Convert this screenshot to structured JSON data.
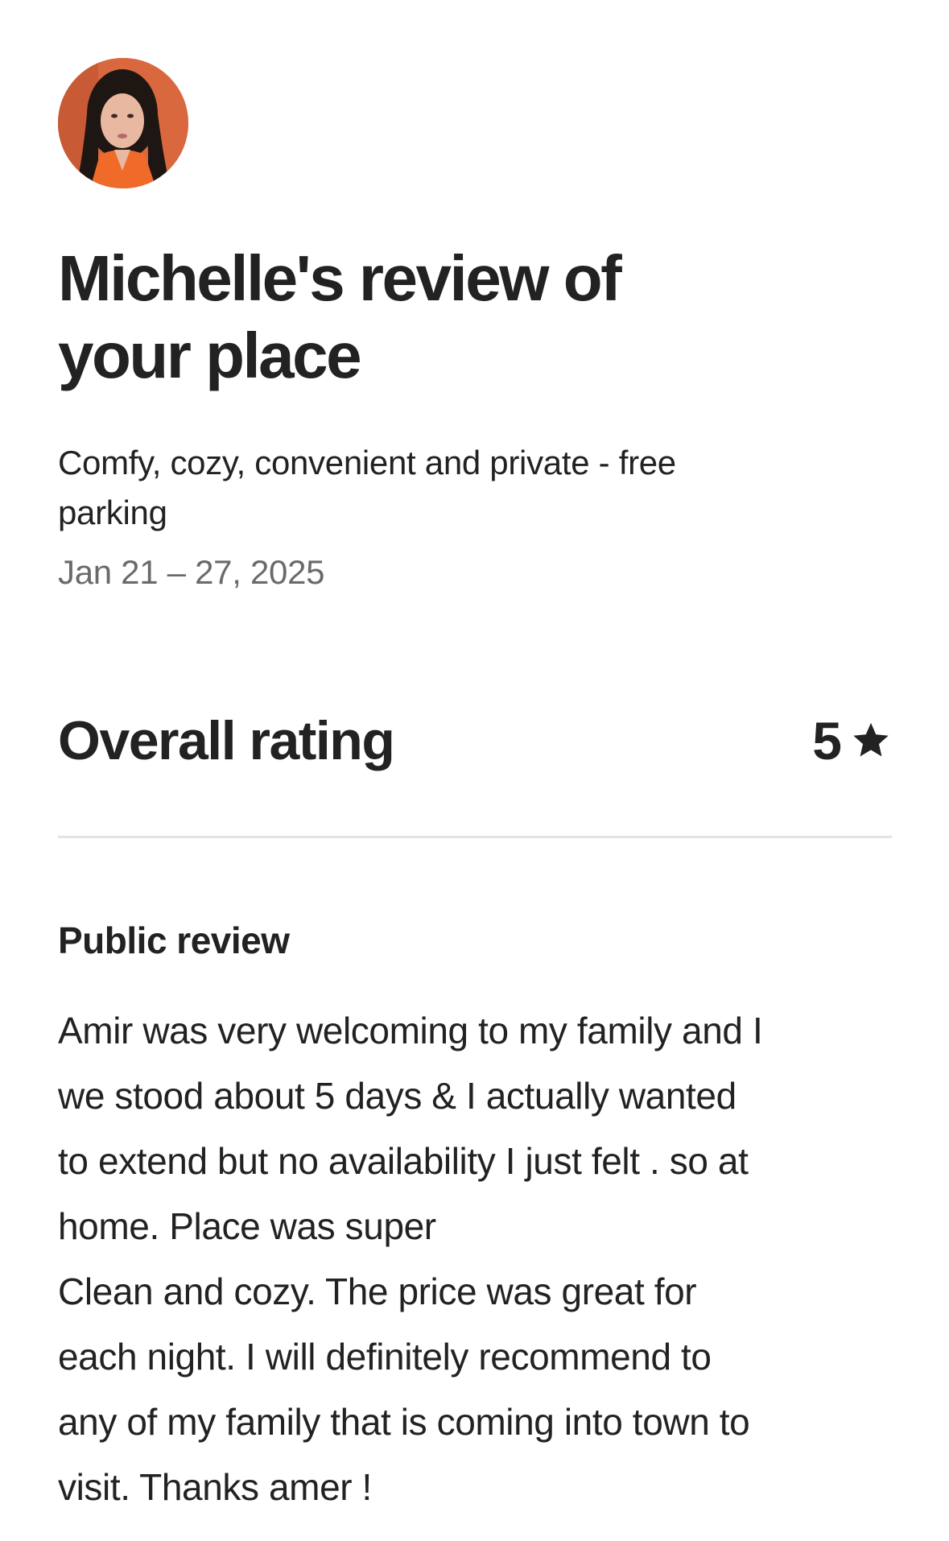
{
  "reviewer": {
    "avatar_icon": "reviewer-avatar-photo",
    "avatar_colors": {
      "background": "#e0552d",
      "hair": "#1e1612",
      "skin": "#e8b8a0",
      "top": "#f06a2a"
    }
  },
  "header": {
    "title": "Michelle's review of your place"
  },
  "listing": {
    "name": "Comfy, cozy, convenient and private - free parking",
    "dates": "Jan 21 – 27, 2025"
  },
  "rating": {
    "label": "Overall rating",
    "value": "5",
    "icon": "star-icon"
  },
  "public_review": {
    "heading": "Public review",
    "lines": [
      "Amir was very welcoming to my family and I",
      "we stood about 5 days & I actually wanted",
      "to extend but no availability I  just felt . so at",
      "home.  Place was super",
      "Clean and cozy. The price was great for",
      "each night. I will definitely recommend to",
      "any of my family that is coming into town to",
      "visit.  Thanks amer !"
    ]
  }
}
